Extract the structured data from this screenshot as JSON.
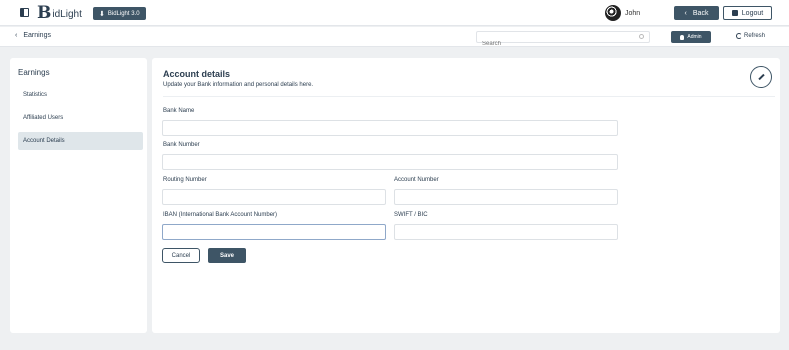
{
  "header": {
    "logo_mark": "B",
    "logo_text": "idLight",
    "version_label": "BidLight 3.0",
    "user_name": "John",
    "back_label": "Back",
    "logout_label": "Logout"
  },
  "subbar": {
    "breadcrumb": "Earnings",
    "search_placeholder": "Search",
    "admin_label": "Admin",
    "refresh_label": "Refresh"
  },
  "sidebar": {
    "title": "Earnings",
    "items": [
      {
        "label": "Statistics",
        "active": false
      },
      {
        "label": "Affiliated Users",
        "active": false
      },
      {
        "label": "Account Details",
        "active": true
      }
    ]
  },
  "main": {
    "title": "Account details",
    "subtitle": "Update your Bank information and personal details here.",
    "fields": {
      "bank_name": {
        "label": "Bank Name",
        "value": ""
      },
      "bank_number": {
        "label": "Bank Number",
        "value": ""
      },
      "routing_number": {
        "label": "Routing Number",
        "value": ""
      },
      "account_number": {
        "label": "Account Number",
        "value": ""
      },
      "iban": {
        "label": "IBAN (International Bank Account Number)",
        "value": ""
      },
      "swift": {
        "label": "SWIFT / BIC",
        "value": ""
      }
    },
    "cancel_label": "Cancel",
    "save_label": "Save"
  }
}
